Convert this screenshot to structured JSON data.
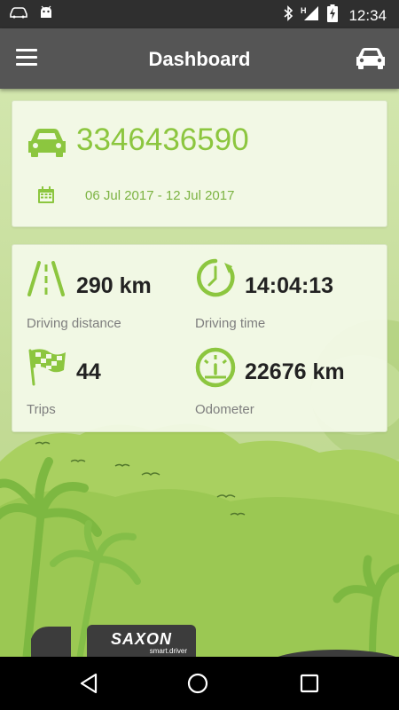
{
  "status_bar": {
    "time": "12:34",
    "icons": [
      "car-notification-icon",
      "android-icon",
      "bluetooth-icon",
      "signal-icon",
      "battery-charging-icon"
    ]
  },
  "app_bar": {
    "title": "Dashboard",
    "menu_icon": "hamburger-menu-icon",
    "action_icon": "car-icon"
  },
  "vehicle": {
    "number": "3346436590",
    "date_range": "06 Jul 2017 - 12 Jul 2017"
  },
  "stats": [
    {
      "value": "290 km",
      "label": "Driving distance",
      "icon": "road-icon"
    },
    {
      "value": "14:04:13",
      "label": "Driving time",
      "icon": "clock-icon"
    },
    {
      "value": "44",
      "label": "Trips",
      "icon": "checkered-flag-icon"
    },
    {
      "value": "22676 km",
      "label": "Odometer",
      "icon": "speedometer-icon"
    }
  ],
  "brand": {
    "name": "SAXON",
    "tagline": "smart.driver"
  },
  "colors": {
    "accent": "#8cc63f",
    "app_bar": "#555555",
    "status_bar": "#2f2f2f"
  }
}
